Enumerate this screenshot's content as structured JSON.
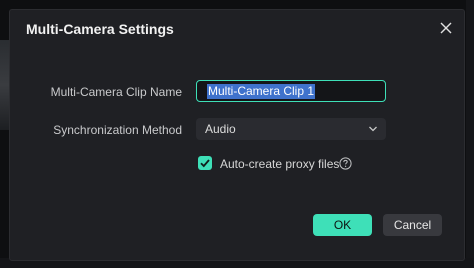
{
  "dialog": {
    "title": "Multi-Camera Settings",
    "close_icon": "close-icon"
  },
  "form": {
    "clip_name_label": "Multi-Camera Clip Name",
    "clip_name_value": "Multi-Camera Clip 1",
    "sync_method_label": "Synchronization Method",
    "sync_method_value": "Audio",
    "sync_dropdown_icon": "chevron-down-icon",
    "proxy_checkbox_checked": true,
    "proxy_label": "Auto-create proxy files",
    "help_icon": "question-circle-icon"
  },
  "buttons": {
    "ok": "OK",
    "cancel": "Cancel"
  },
  "colors": {
    "accent": "#3ee0b8",
    "dialog_bg": "#1f2024",
    "selection": "#3f72cc"
  }
}
